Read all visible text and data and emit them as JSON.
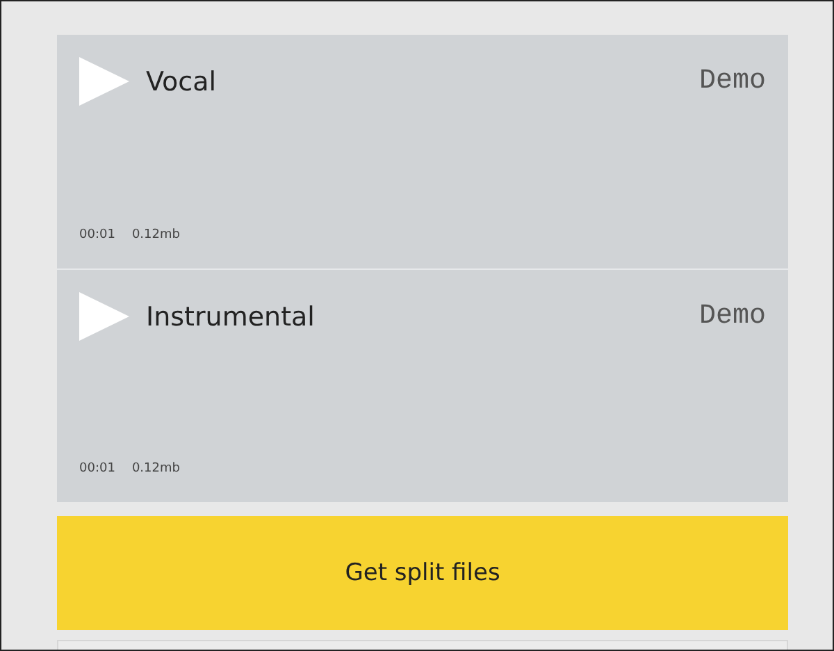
{
  "tracks": [
    {
      "name": "Vocal",
      "badge": "Demo",
      "duration": "00:01",
      "size": "0.12mb"
    },
    {
      "name": "Instrumental",
      "badge": "Demo",
      "duration": "00:01",
      "size": "0.12mb"
    }
  ],
  "action_button": "Get split files"
}
